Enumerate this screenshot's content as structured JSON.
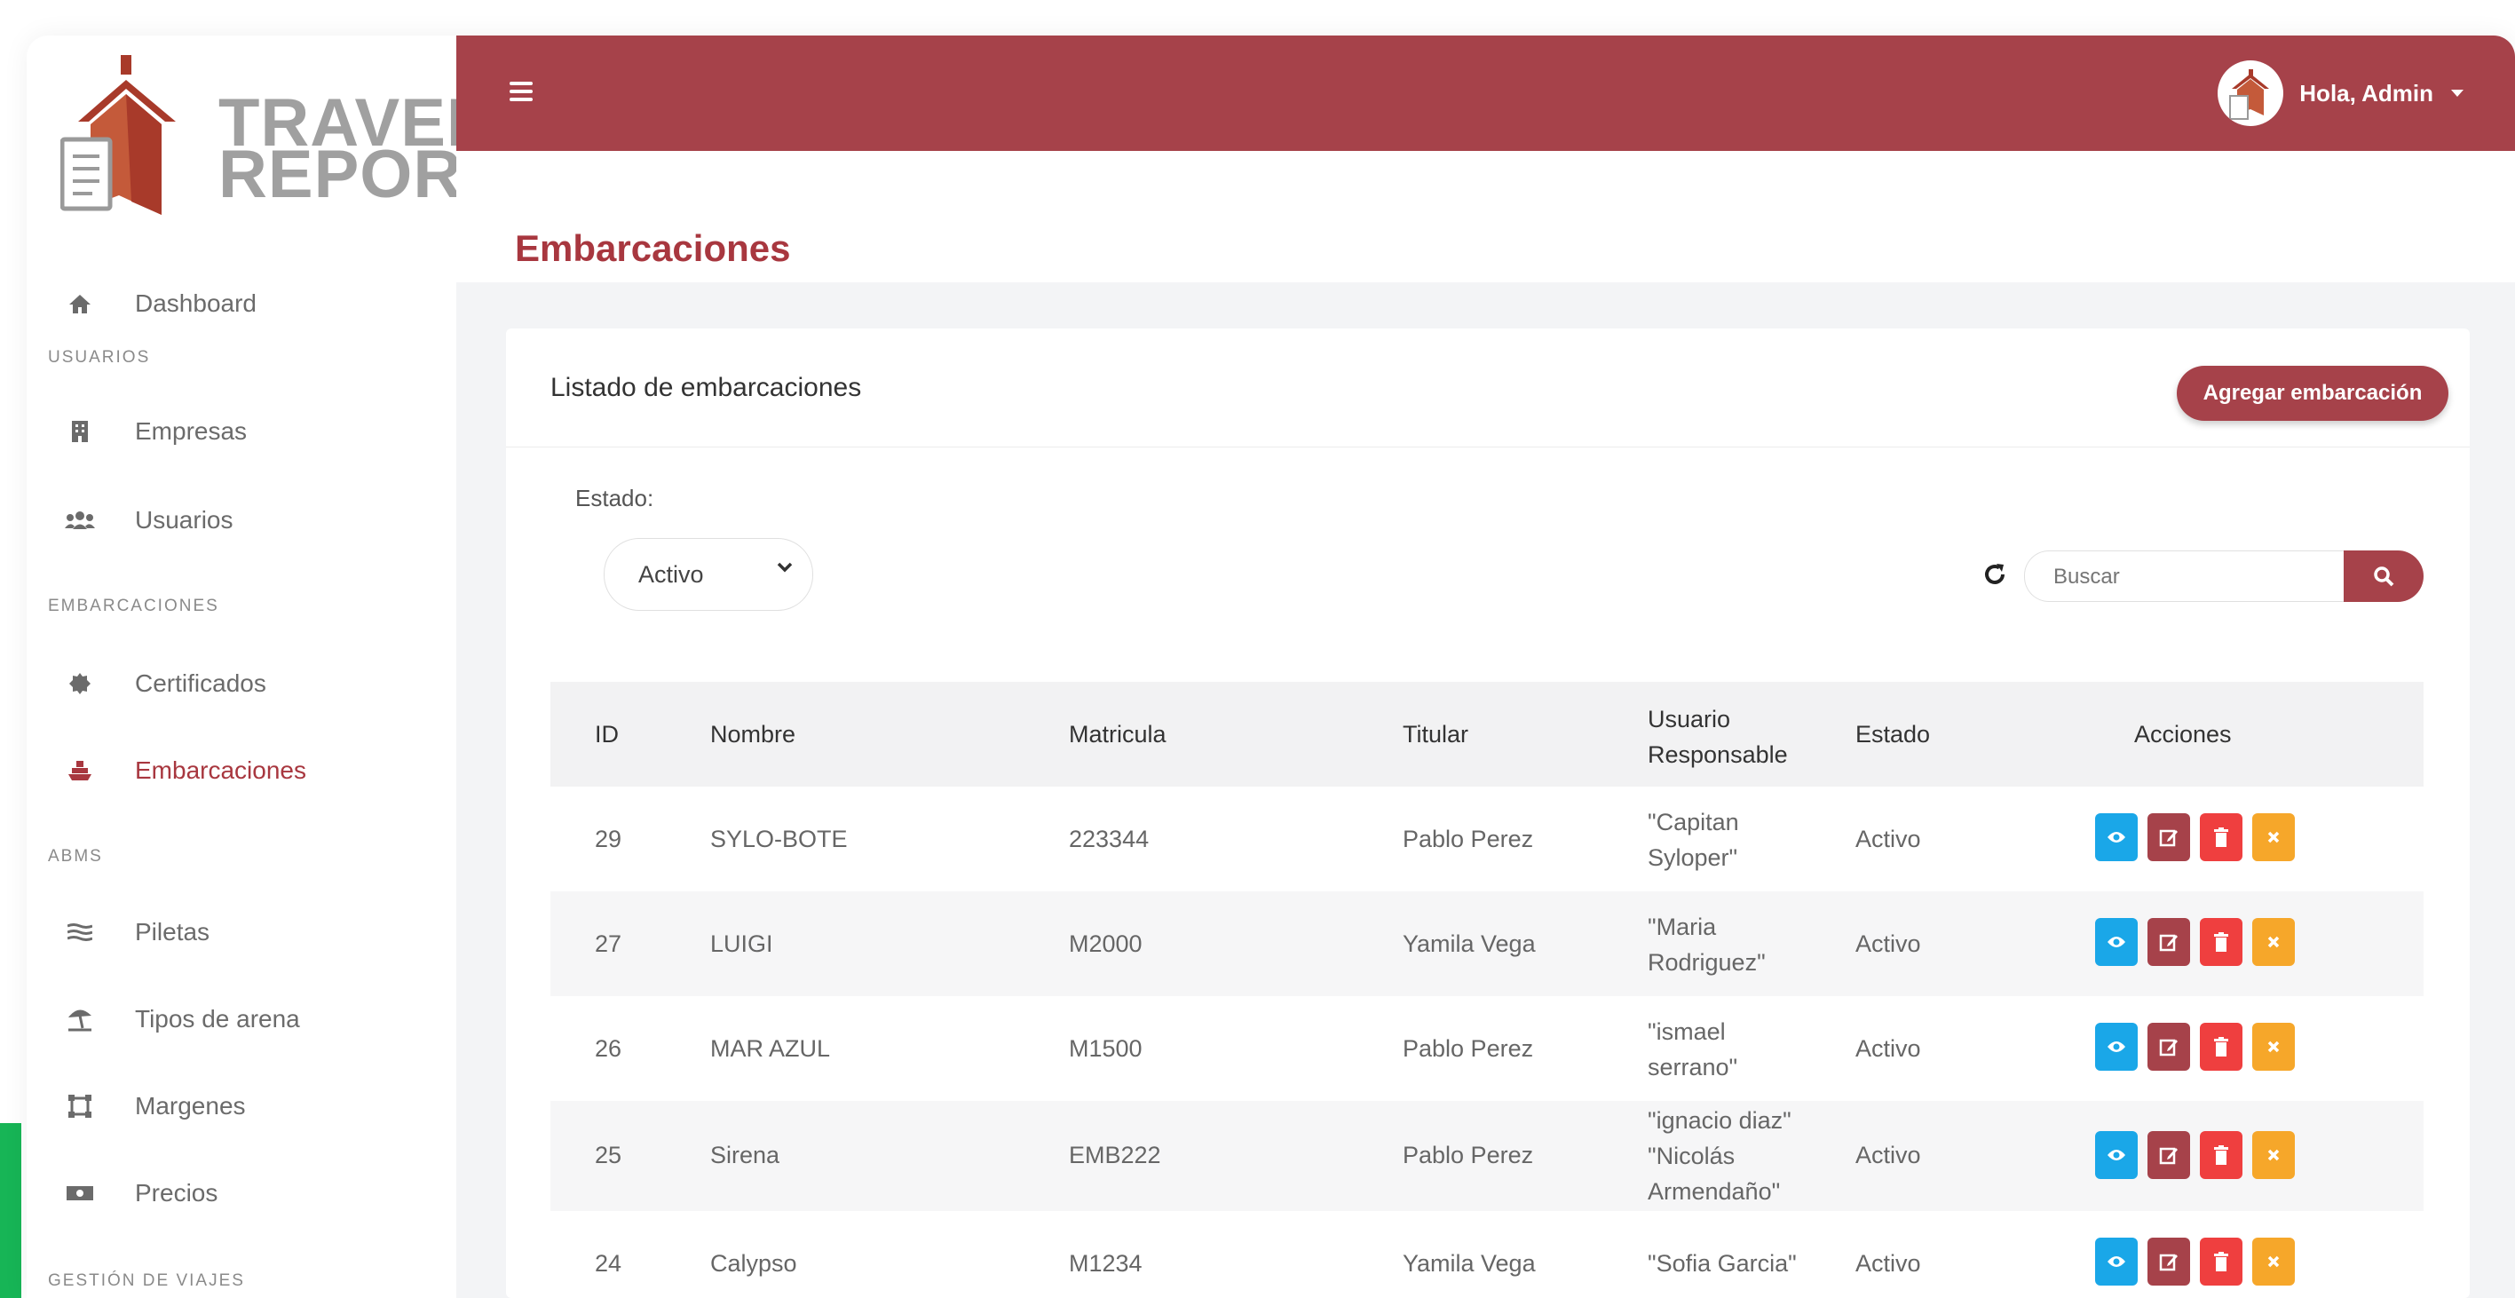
{
  "logo": {
    "line1": "TRAVEL",
    "line2": "REPORT"
  },
  "sidebar": {
    "items": [
      {
        "label": "Dashboard",
        "icon": "home-icon"
      },
      {
        "section": "USUARIOS"
      },
      {
        "label": "Empresas",
        "icon": "building-icon"
      },
      {
        "label": "Usuarios",
        "icon": "users-icon"
      },
      {
        "section": "EMBARCACIONES"
      },
      {
        "label": "Certificados",
        "icon": "certificate-icon"
      },
      {
        "label": "Embarcaciones",
        "icon": "ship-icon",
        "active": true
      },
      {
        "section": "ABMS"
      },
      {
        "label": "Piletas",
        "icon": "water-icon"
      },
      {
        "label": "Tipos de arena",
        "icon": "umbrella-beach-icon"
      },
      {
        "label": "Margenes",
        "icon": "border-icon"
      },
      {
        "label": "Precios",
        "icon": "money-icon"
      },
      {
        "section": "GESTIÓN DE VIAJES"
      }
    ]
  },
  "header": {
    "user": "Hola, Admin"
  },
  "page": {
    "title": "Embarcaciones"
  },
  "card": {
    "title": "Listado de embarcaciones",
    "add_button": "Agregar embarcación",
    "filter_label": "Estado:",
    "filter_value": "Activo",
    "search_placeholder": "Buscar"
  },
  "table": {
    "headers": [
      "ID",
      "Nombre",
      "Matricula",
      "Titular",
      "Usuario Responsable",
      "Estado",
      "Acciones"
    ],
    "rows": [
      {
        "id": "29",
        "nombre": "SYLO-BOTE",
        "matricula": "223344",
        "titular": "Pablo Perez",
        "responsable": [
          "\"Capitan",
          "Syloper\""
        ],
        "estado": "Activo"
      },
      {
        "id": "27",
        "nombre": "LUIGI",
        "matricula": "M2000",
        "titular": "Yamila Vega",
        "responsable": [
          "\"Maria",
          "Rodriguez\""
        ],
        "estado": "Activo"
      },
      {
        "id": "26",
        "nombre": "MAR AZUL",
        "matricula": "M1500",
        "titular": "Pablo Perez",
        "responsable": [
          "\"ismael",
          "serrano\""
        ],
        "estado": "Activo"
      },
      {
        "id": "25",
        "nombre": "Sirena",
        "matricula": "EMB222",
        "titular": "Pablo Perez",
        "responsable": [
          "\"ignacio diaz\"",
          "\"Nicolás",
          "Armendaño\""
        ],
        "estado": "Activo"
      },
      {
        "id": "24",
        "nombre": "Calypso",
        "matricula": "M1234",
        "titular": "Yamila Vega",
        "responsable": [
          "\"Sofia Garcia\""
        ],
        "estado": "Activo"
      }
    ]
  },
  "colors": {
    "brand": "#a6424a",
    "view": "#1aa7e8",
    "delete": "#ef3f3f",
    "cancel": "#f6a72a"
  }
}
